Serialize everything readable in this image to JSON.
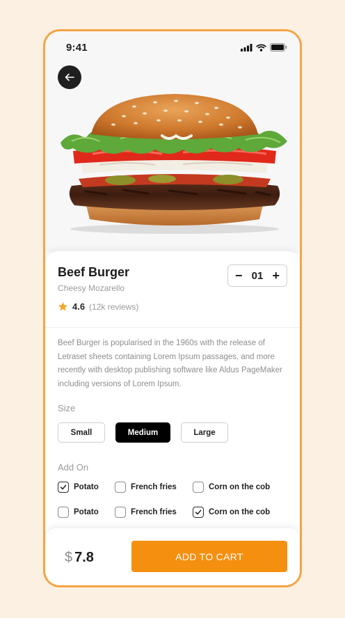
{
  "status": {
    "time": "9:41"
  },
  "product": {
    "name": "Beef Burger",
    "variant": "Cheesy Mozarello",
    "rating": "4.6",
    "reviews": "(12k reviews)",
    "quantity": "01",
    "description": "Beef Burger is popularised in the 1960s with the release of Letraset sheets containing Lorem Ipsum passages, and more recently with desktop publishing software like Aldus PageMaker including versions of Lorem Ipsum."
  },
  "stepper": {
    "minus": "−",
    "plus": "+"
  },
  "size": {
    "label": "Size",
    "options": [
      "Small",
      "Medium",
      "Large"
    ],
    "selected": "Medium"
  },
  "addon": {
    "label": "Add On",
    "rows": [
      [
        {
          "label": "Potato",
          "checked": true
        },
        {
          "label": "French fries",
          "checked": false
        },
        {
          "label": "Corn on the cob",
          "checked": false
        }
      ],
      [
        {
          "label": "Potato",
          "checked": false
        },
        {
          "label": "French fries",
          "checked": false
        },
        {
          "label": "Corn on the cob",
          "checked": true
        }
      ]
    ]
  },
  "footer": {
    "currency": "$",
    "price": "7.8",
    "cta": "ADD TO CART"
  },
  "colors": {
    "accent": "#f58f0f",
    "frame": "#f5a443",
    "background": "#fcf0e2",
    "star": "#f5a623"
  },
  "icons": {
    "back": "arrow-left-icon",
    "rating": "star-icon",
    "signal": "signal-icon",
    "wifi": "wifi-icon",
    "battery": "battery-icon"
  }
}
